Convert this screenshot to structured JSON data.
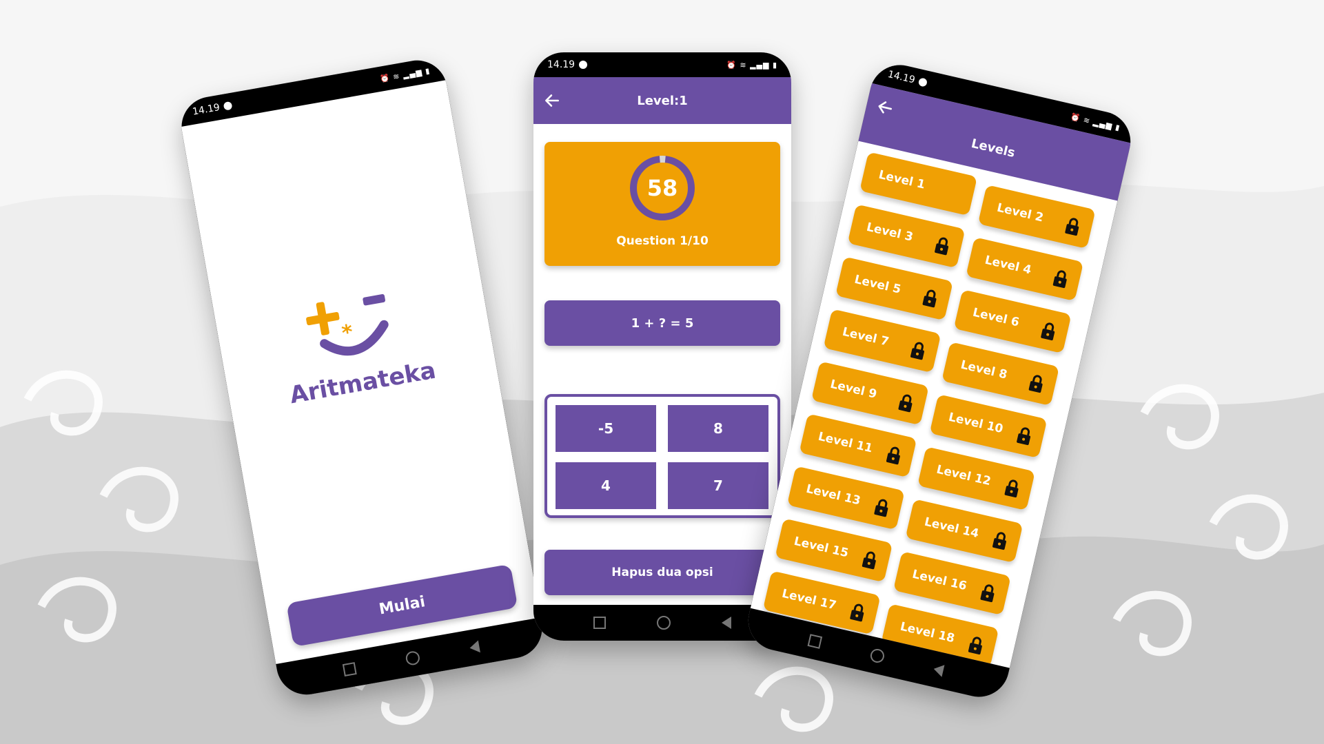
{
  "colors": {
    "purple": "#6a4fa3",
    "orange": "#f0a004",
    "background": "#e9e9e9"
  },
  "status_bar": {
    "time": "14.19"
  },
  "splash": {
    "app_name": "Aritmateka",
    "start_button": "Mulai"
  },
  "quiz": {
    "title": "Level:1",
    "timer": "58",
    "timer_progress": 0.97,
    "question_counter": "Question 1/10",
    "equation": "1 + ? = 5",
    "options": [
      "-5",
      "8",
      "4",
      "7"
    ],
    "hint_button": "Hapus dua opsi"
  },
  "levels_screen": {
    "title": "Levels",
    "levels": [
      {
        "label": "Level 1",
        "locked": false
      },
      {
        "label": "Level 2",
        "locked": true
      },
      {
        "label": "Level 3",
        "locked": true
      },
      {
        "label": "Level 4",
        "locked": true
      },
      {
        "label": "Level 5",
        "locked": true
      },
      {
        "label": "Level 6",
        "locked": true
      },
      {
        "label": "Level 7",
        "locked": true
      },
      {
        "label": "Level 8",
        "locked": true
      },
      {
        "label": "Level 9",
        "locked": true
      },
      {
        "label": "Level 10",
        "locked": true
      },
      {
        "label": "Level 11",
        "locked": true
      },
      {
        "label": "Level 12",
        "locked": true
      },
      {
        "label": "Level 13",
        "locked": true
      },
      {
        "label": "Level 14",
        "locked": true
      },
      {
        "label": "Level 15",
        "locked": true
      },
      {
        "label": "Level 16",
        "locked": true
      },
      {
        "label": "Level 17",
        "locked": true
      },
      {
        "label": "Level 18",
        "locked": true
      }
    ]
  },
  "icons": [
    "back-arrow-icon",
    "lock-icon",
    "wifi-icon",
    "signal-icon",
    "battery-icon",
    "alarm-icon",
    "nav-square-icon",
    "nav-home-icon",
    "nav-back-icon"
  ]
}
